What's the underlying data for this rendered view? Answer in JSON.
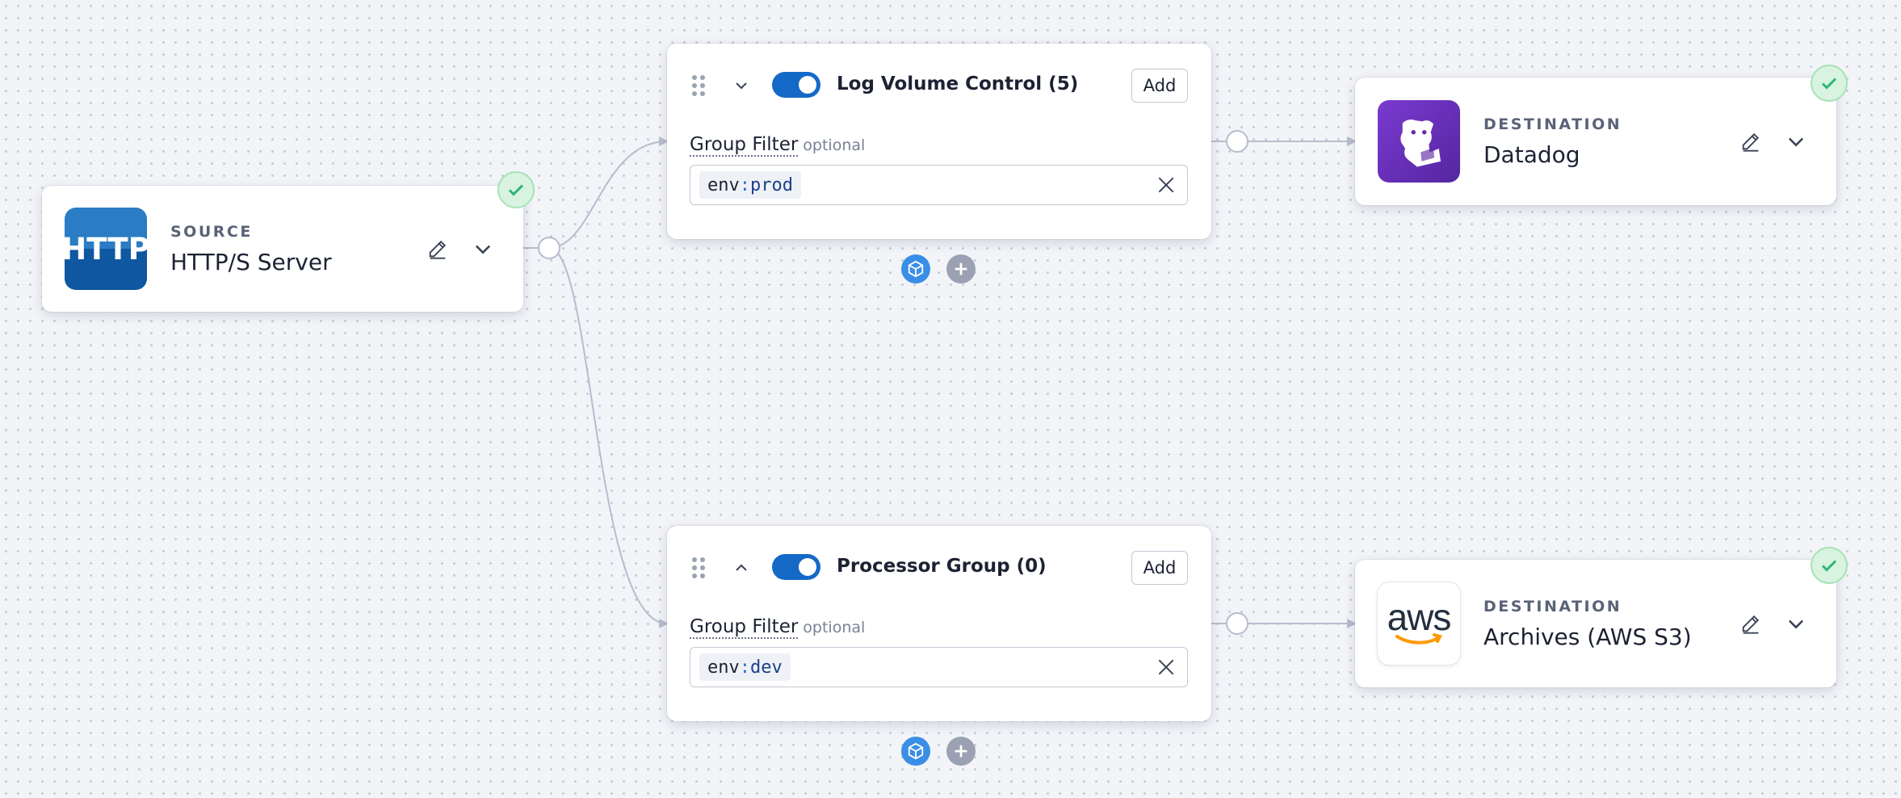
{
  "source": {
    "kind": "SOURCE",
    "name": "HTTP/S Server",
    "logo_text": "HTTP",
    "status": "valid"
  },
  "groups": [
    {
      "title": "Log Volume Control (5)",
      "expanded": false,
      "enabled": true,
      "add_label": "Add",
      "filter_label": "Group Filter",
      "filter_optional": "optional",
      "query_key": "env",
      "query_sep": ":",
      "query_value": "prod"
    },
    {
      "title": "Processor Group (0)",
      "expanded": true,
      "enabled": true,
      "add_label": "Add",
      "filter_label": "Group Filter",
      "filter_optional": "optional",
      "query_key": "env",
      "query_sep": ":",
      "query_value": "dev"
    }
  ],
  "destinations": [
    {
      "kind": "DESTINATION",
      "name": "Datadog",
      "logo": "datadog-logo",
      "status": "valid"
    },
    {
      "kind": "DESTINATION",
      "name": "Archives (AWS S3)",
      "logo": "aws-logo",
      "logo_text": "aws",
      "status": "valid"
    }
  ],
  "colors": {
    "accent": "#1469c7",
    "success": "#2bb673",
    "wire": "#b6bdcc",
    "datadog": "#632ca6",
    "http": "#1262a8",
    "aws_smile": "#ff9900"
  }
}
